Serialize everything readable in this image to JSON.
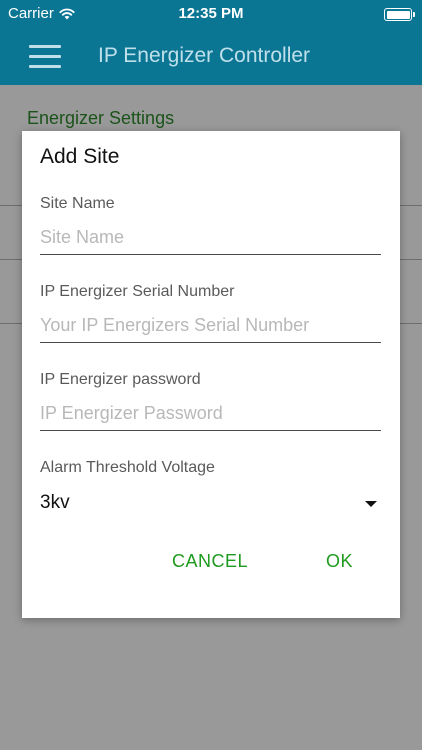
{
  "status_bar": {
    "carrier": "Carrier",
    "time": "12:35 PM",
    "battery_level": 1.0
  },
  "app_bar": {
    "title": "IP Energizer Controller",
    "menu_icon": "hamburger-menu-icon"
  },
  "page": {
    "section_title": "Energizer Settings"
  },
  "dialog": {
    "title": "Add Site",
    "fields": [
      {
        "label": "Site Name",
        "value": "",
        "placeholder": "Site Name"
      },
      {
        "label": "IP Energizer Serial Number",
        "value": "",
        "placeholder": "Your IP Energizers Serial Number"
      },
      {
        "label": "IP Energizer password",
        "value": "",
        "placeholder": "IP Energizer Password"
      }
    ],
    "alarm": {
      "label": "Alarm Threshold Voltage",
      "selected": "3kv"
    },
    "cancel_label": "CANCEL",
    "ok_label": "OK"
  },
  "colors": {
    "primary": "#0a7694",
    "accent_green": "#1e9a1e",
    "section_green": "#2e8b2e",
    "app_bar_text": "#bfe0ea"
  }
}
